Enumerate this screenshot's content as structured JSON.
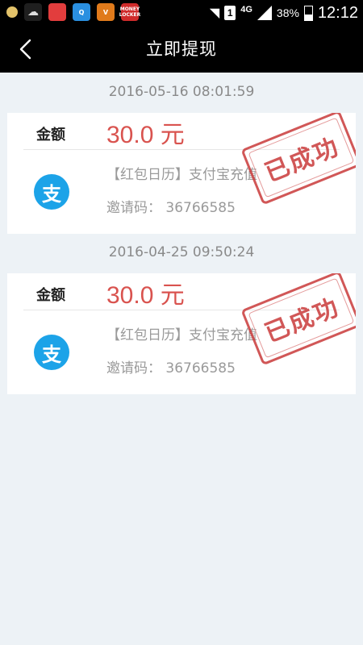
{
  "status_bar": {
    "app_icons": [
      "notification-dot-icon",
      "wechat-icon",
      "red-app-icon",
      "q-app-icon",
      "orange-app-icon",
      "money-locker-icon"
    ],
    "money_locker_label": "MONEY LOCKER",
    "sim_label": "1",
    "network_label": "4G",
    "battery_percent": "38%",
    "time": "12:12"
  },
  "header": {
    "title": "立即提现"
  },
  "records": [
    {
      "date": "2016-05-16 08:01:59",
      "amount_label": "金额",
      "amount": "30.0 元",
      "description": "【红包日历】支付宝充值",
      "invite_code_text": "邀请码： 36766585",
      "stamp_text": "已成功",
      "icon_char": "支"
    },
    {
      "date": "2016-04-25 09:50:24",
      "amount_label": "金额",
      "amount": "30.0 元",
      "description": "【红包日历】支付宝充值",
      "invite_code_text": "邀请码： 36766585",
      "stamp_text": "已成功",
      "icon_char": "支"
    }
  ],
  "colors": {
    "accent_red": "#d9534f",
    "alipay_blue": "#1ca3e8",
    "background": "#edf2f6"
  }
}
